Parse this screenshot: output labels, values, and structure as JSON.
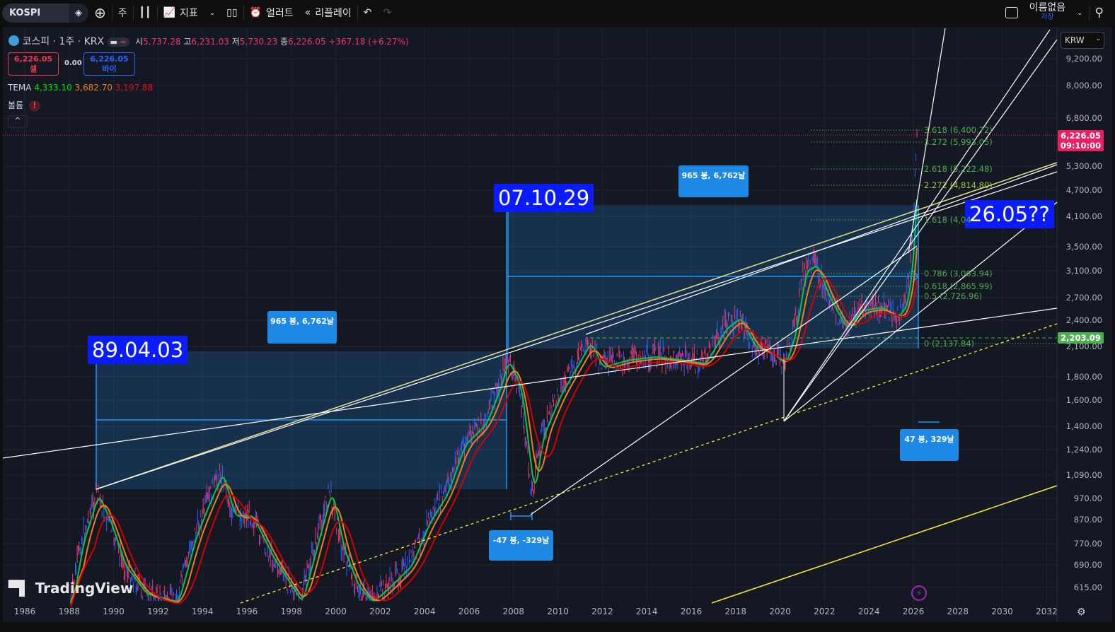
{
  "toolbar": {
    "symbol": "KOSPI",
    "interval": "주",
    "indicators": "지표",
    "alerts": "얼러트",
    "replay": "리플레이",
    "layout_name": "이름없음",
    "save": "저장"
  },
  "legend": {
    "title": "코스피 · 1주 · KRX",
    "open_label": "시",
    "open": "5,737.28",
    "high_label": "고",
    "high": "6,231.03",
    "low_label": "저",
    "low": "5,730.23",
    "close_label": "종",
    "close": "6,226.05",
    "change": "+367.18 (+6.27%)",
    "sell_price": "6,226.05",
    "sell_label": "셀",
    "spread": "0.00",
    "buy_price": "6,226.05",
    "buy_label": "바이",
    "tema_label": "TEMA",
    "tema": [
      "4,333.10",
      "3,682.70",
      "3,197.88"
    ],
    "volume_label": "볼륨",
    "volume_warning": "!",
    "collapse": "^"
  },
  "currency": "KRW",
  "price_axis": [
    "9,200.00",
    "8,000.00",
    "6,800.00",
    "5,300.00",
    "4,700.00",
    "4,100.00",
    "3,500.00",
    "3,100.00",
    "2,700.00",
    "2,400.00",
    "2,100.00",
    "1,800.00",
    "1,600.00",
    "1,400.00",
    "1,240.00",
    "1,090.00",
    "970.00",
    "870.00",
    "770.00",
    "690.00",
    "615.00"
  ],
  "time_axis": [
    "1986",
    "1988",
    "1990",
    "1992",
    "1994",
    "1996",
    "1998",
    "2000",
    "2002",
    "2004",
    "2006",
    "2008",
    "2010",
    "2012",
    "2014",
    "2016",
    "2018",
    "2020",
    "2022",
    "2024",
    "2026",
    "2028",
    "2030",
    "2032"
  ],
  "last_price": {
    "price": "6,226.05",
    "countdown": "09:10:00",
    "color": "#e91e63"
  },
  "level_tag": {
    "price": "2,203.09",
    "color": "#4caf50"
  },
  "annotations": {
    "date1": "89.04.03",
    "date2": "07.10.29",
    "date3": "26.05??",
    "range1": "965 봉, 6,762날",
    "range2": "965 봉, 6,762날",
    "range3": "-47 봉, -329날",
    "range4": "47 봉, 329날"
  },
  "fib_levels": [
    "3.618 (6,400.72)",
    "3.272 (5,993.05)",
    "2.618 (5,222.48)",
    "2.272 (4,814.80)",
    "1.618 (4,04",
    "0.786 (3,063.94)",
    "0.618 (2,865.99)",
    "0.5 (2,726.96)",
    "0 (2,137.84)"
  ],
  "watermark": "TradingView",
  "colors": {
    "background": "#141823",
    "up": "#f23669",
    "down": "#2962ff",
    "tema_fast": "#00c853",
    "tema_mid": "#ef7f1a",
    "tema_slow": "#d50000",
    "trend_yellow": "#ffeb3b",
    "box_fill": "#1e88e5",
    "label_blue": "#0a1cff"
  }
}
